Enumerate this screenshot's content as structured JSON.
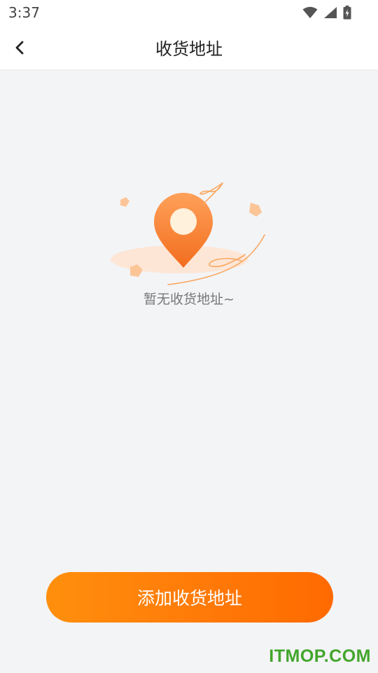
{
  "status_bar": {
    "time": "3:37",
    "icons": [
      "wifi-icon",
      "signal-icon",
      "battery-icon"
    ]
  },
  "header": {
    "title": "收货地址",
    "back_icon": "chevron-left-icon"
  },
  "empty_state": {
    "message": "暂无收货地址~",
    "illustration": "location-pin-icon"
  },
  "actions": {
    "add_address_label": "添加收货地址"
  },
  "watermark": {
    "text": "ITMOP.COM"
  },
  "colors": {
    "accent": "#ff7a08",
    "background": "#f3f4f6",
    "watermark": "#43a52c"
  }
}
